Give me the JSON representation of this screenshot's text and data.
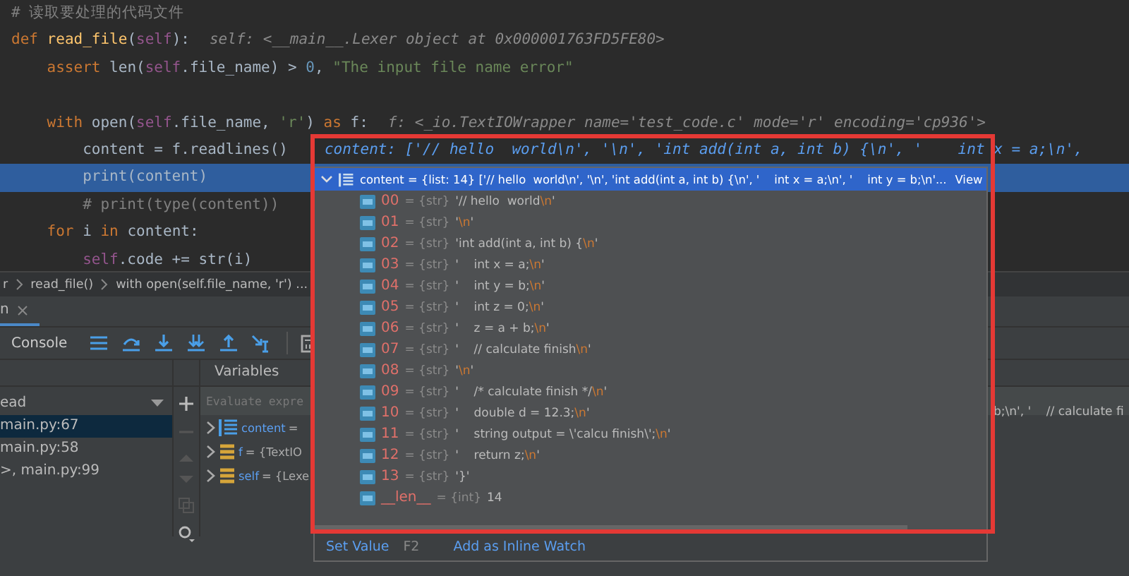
{
  "editor": {
    "lines": [
      {
        "selected": false,
        "tokens": [
          {
            "kind": "comment",
            "text": "# 读取要处理的代码文件"
          }
        ]
      },
      {
        "selected": false,
        "tokens": [
          {
            "kind": "keyword",
            "text": "def "
          },
          {
            "kind": "func",
            "text": "read_file"
          },
          {
            "kind": "plain",
            "text": "("
          },
          {
            "kind": "self",
            "text": "self"
          },
          {
            "kind": "plain",
            "text": "):"
          }
        ],
        "hint": "self: <__main__.Lexer object at 0x000001763FD5FE80>"
      },
      {
        "selected": false,
        "tokens": [
          {
            "kind": "keyword",
            "text": "    assert "
          },
          {
            "kind": "plain",
            "text": "len("
          },
          {
            "kind": "self",
            "text": "self"
          },
          {
            "kind": "plain",
            "text": ".file_name) > "
          },
          {
            "kind": "number",
            "text": "0"
          },
          {
            "kind": "plain",
            "text": ", "
          },
          {
            "kind": "string",
            "text": "\"The input file name error\""
          }
        ]
      },
      {
        "selected": false
      },
      {
        "selected": false,
        "tokens": [
          {
            "kind": "keyword",
            "text": "    with "
          },
          {
            "kind": "plain",
            "text": "open("
          },
          {
            "kind": "self",
            "text": "self"
          },
          {
            "kind": "plain",
            "text": ".file_name, "
          },
          {
            "kind": "string",
            "text": "'r'"
          },
          {
            "kind": "plain",
            "text": ") "
          },
          {
            "kind": "keyword",
            "text": "as"
          },
          {
            "kind": "plain",
            "text": " f:"
          }
        ],
        "hint": "f: <_io.TextIOWrapper name='test_code.c' mode='r' encoding='cp936'>"
      },
      {
        "selected": false,
        "tokens": [
          {
            "kind": "plain",
            "text": "        content = f.readlines()"
          }
        ],
        "value_hint": "content: ['// hello  world\\n', '\\n', 'int add(int a, int b) {\\n', '    int x = a;\\n',"
      },
      {
        "selected": true,
        "tokens": [
          {
            "kind": "plain",
            "text": "        print(content)"
          }
        ]
      },
      {
        "selected": false,
        "tokens": [
          {
            "kind": "comment",
            "text": "        # print(type(content))"
          }
        ]
      },
      {
        "selected": false,
        "tokens": [
          {
            "kind": "keyword",
            "text": "    for"
          },
          {
            "kind": "plain",
            "text": " i "
          },
          {
            "kind": "keyword",
            "text": "in"
          },
          {
            "kind": "plain",
            "text": " content:"
          }
        ]
      },
      {
        "selected": false,
        "tokens": [
          {
            "kind": "self",
            "text": "        self"
          },
          {
            "kind": "plain",
            "text": ".code += str(i)"
          }
        ]
      }
    ]
  },
  "breadcrumbs": [
    "r",
    "read_file()",
    "with open(self.file_name, 'r') ..."
  ],
  "debug_tab": {
    "label": "n"
  },
  "toolbar": {
    "console": "Console"
  },
  "variables_title": "Variables",
  "frames": {
    "thread": "ead",
    "items": [
      {
        "label": "main.py:67",
        "selected": true
      },
      {
        "label": "main.py:58",
        "selected": false
      },
      {
        "label": ">, main.py:99",
        "selected": false
      }
    ]
  },
  "variables": {
    "placeholder": "Evaluate expre",
    "rows": [
      {
        "kind": "list",
        "name": "content",
        "value": "="
      },
      {
        "kind": "object",
        "name": "f",
        "value": "= {TextIO"
      },
      {
        "kind": "object",
        "name": "self",
        "value": "= {Lexe"
      }
    ],
    "content_tail": "b;\\n', '    // calculate fi"
  },
  "popup": {
    "header": "content = {list: 14} ['// hello  world\\n', '\\n', 'int add(int a, int b) {\\n', '    int x = a;\\n', '    int y = b;\\n'...",
    "view": "View",
    "items": [
      {
        "index": "00",
        "type": "= {str}",
        "value": [
          {
            "kind": "text",
            "text": "'// hello  world"
          },
          {
            "kind": "escape",
            "text": "\\n"
          },
          {
            "kind": "text",
            "text": "'"
          }
        ]
      },
      {
        "index": "01",
        "type": "= {str}",
        "value": [
          {
            "kind": "text",
            "text": "'"
          },
          {
            "kind": "escape",
            "text": "\\n"
          },
          {
            "kind": "text",
            "text": "'"
          }
        ]
      },
      {
        "index": "02",
        "type": "= {str}",
        "value": [
          {
            "kind": "text",
            "text": "'int add(int a, int b) {"
          },
          {
            "kind": "escape",
            "text": "\\n"
          },
          {
            "kind": "text",
            "text": "'"
          }
        ]
      },
      {
        "index": "03",
        "type": "= {str}",
        "value": [
          {
            "kind": "text",
            "text": "'    int x = a;"
          },
          {
            "kind": "escape",
            "text": "\\n"
          },
          {
            "kind": "text",
            "text": "'"
          }
        ]
      },
      {
        "index": "04",
        "type": "= {str}",
        "value": [
          {
            "kind": "text",
            "text": "'    int y = b;"
          },
          {
            "kind": "escape",
            "text": "\\n"
          },
          {
            "kind": "text",
            "text": "'"
          }
        ]
      },
      {
        "index": "05",
        "type": "= {str}",
        "value": [
          {
            "kind": "text",
            "text": "'    int z = 0;"
          },
          {
            "kind": "escape",
            "text": "\\n"
          },
          {
            "kind": "text",
            "text": "'"
          }
        ]
      },
      {
        "index": "06",
        "type": "= {str}",
        "value": [
          {
            "kind": "text",
            "text": "'    z = a + b;"
          },
          {
            "kind": "escape",
            "text": "\\n"
          },
          {
            "kind": "text",
            "text": "'"
          }
        ]
      },
      {
        "index": "07",
        "type": "= {str}",
        "value": [
          {
            "kind": "text",
            "text": "'    // calculate finish"
          },
          {
            "kind": "escape",
            "text": "\\n"
          },
          {
            "kind": "text",
            "text": "'"
          }
        ]
      },
      {
        "index": "08",
        "type": "= {str}",
        "value": [
          {
            "kind": "text",
            "text": "'"
          },
          {
            "kind": "escape",
            "text": "\\n"
          },
          {
            "kind": "text",
            "text": "'"
          }
        ]
      },
      {
        "index": "09",
        "type": "= {str}",
        "value": [
          {
            "kind": "text",
            "text": "'    /* calculate finish */"
          },
          {
            "kind": "escape",
            "text": "\\n"
          },
          {
            "kind": "text",
            "text": "'"
          }
        ]
      },
      {
        "index": "10",
        "type": "= {str}",
        "value": [
          {
            "kind": "text",
            "text": "'    double d = 12.3;"
          },
          {
            "kind": "escape",
            "text": "\\n"
          },
          {
            "kind": "text",
            "text": "'"
          }
        ]
      },
      {
        "index": "11",
        "type": "= {str}",
        "value": [
          {
            "kind": "text",
            "text": "'    string output = \\'calcu finish\\';"
          },
          {
            "kind": "escape",
            "text": "\\n"
          },
          {
            "kind": "text",
            "text": "'"
          }
        ]
      },
      {
        "index": "12",
        "type": "= {str}",
        "value": [
          {
            "kind": "text",
            "text": "'    return z;"
          },
          {
            "kind": "escape",
            "text": "\\n"
          },
          {
            "kind": "text",
            "text": "'"
          }
        ]
      },
      {
        "index": "13",
        "type": "= {str}",
        "value": [
          {
            "kind": "text",
            "text": "'}'"
          }
        ]
      },
      {
        "index": "__len__",
        "type": "= {int}",
        "value": [
          {
            "kind": "text",
            "text": "14"
          }
        ]
      }
    ],
    "footer": {
      "set_value": "Set Value",
      "shortcut": "F2",
      "inline_watch": "Add as Inline Watch"
    }
  }
}
